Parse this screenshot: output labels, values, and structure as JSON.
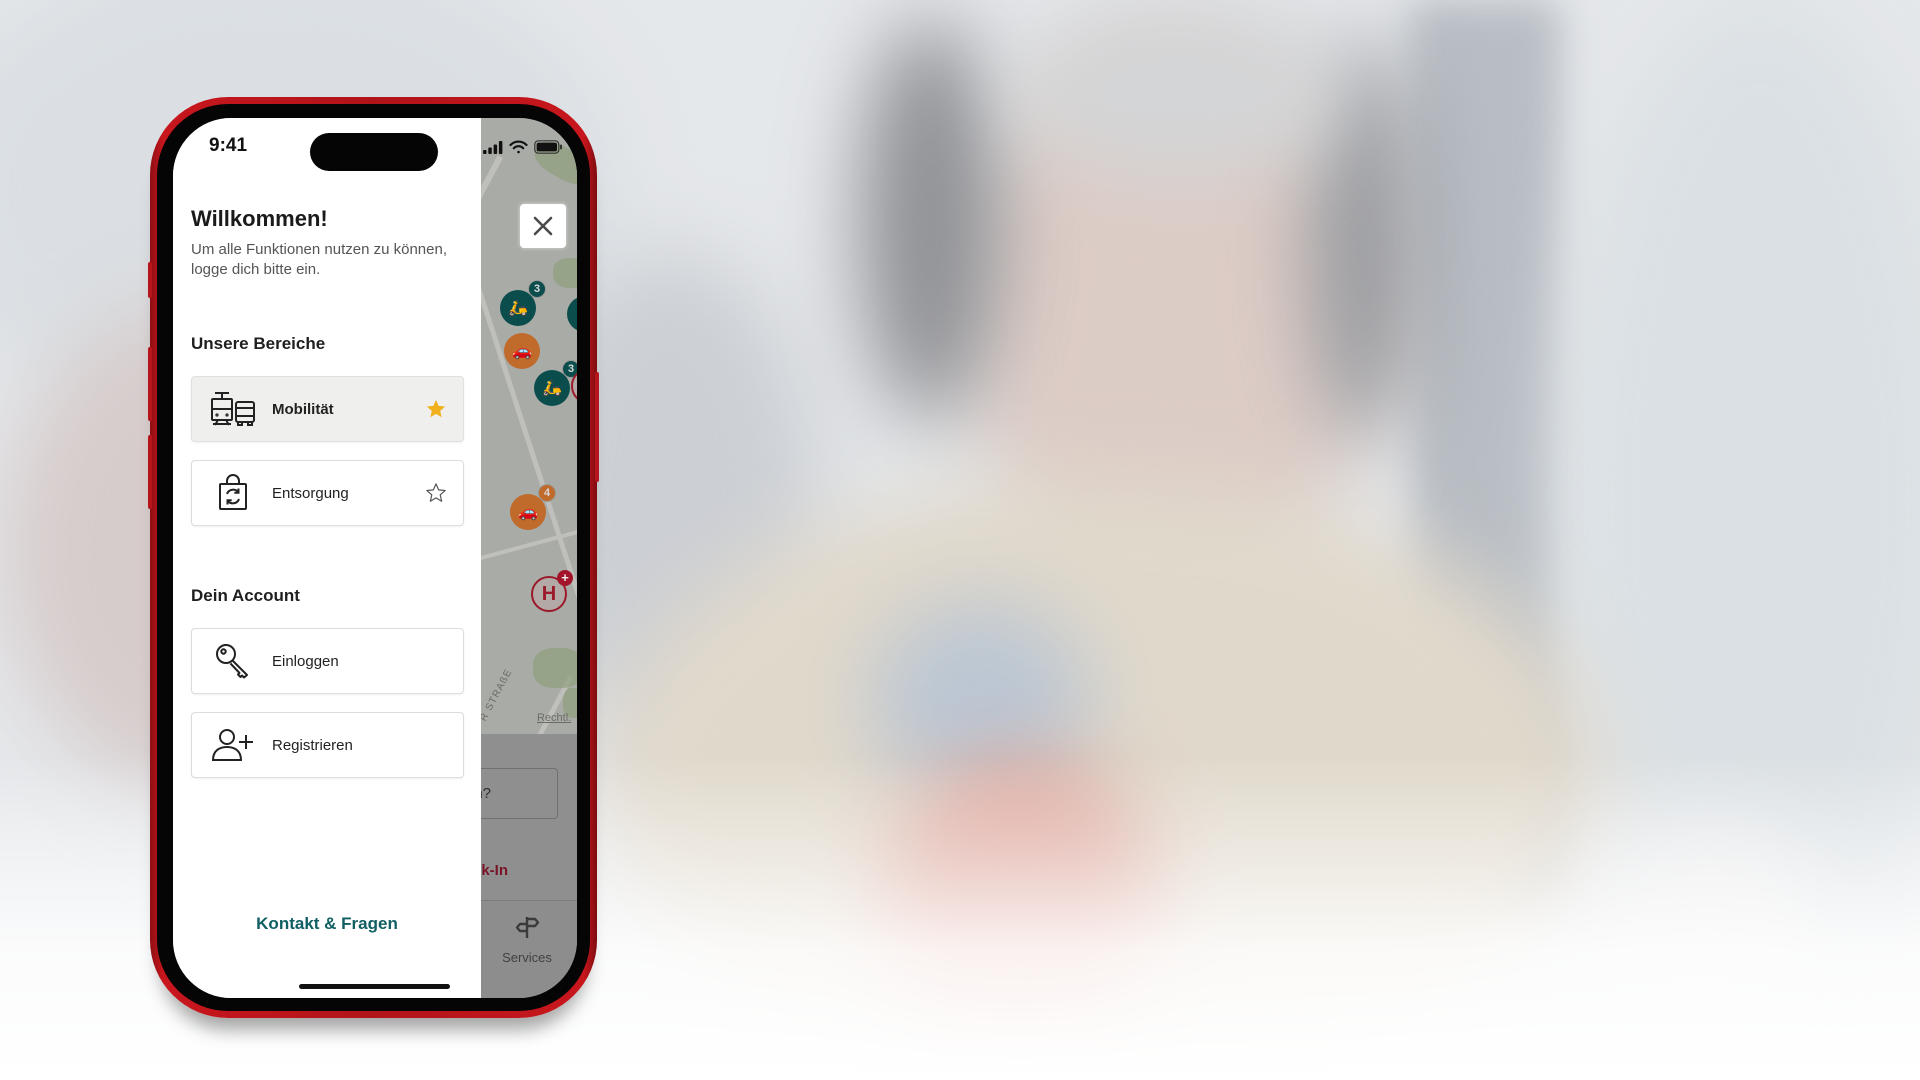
{
  "status_bar": {
    "time": "9:41",
    "icons": [
      "cellular-signal-icon",
      "wifi-icon",
      "battery-icon"
    ]
  },
  "drawer": {
    "title": "Willkommen!",
    "subtitle": "Um alle Funktionen nutzen zu können, logge dich bitte ein.",
    "close_icon": "close-icon",
    "sections": {
      "areas": {
        "heading": "Unsere Bereiche",
        "items": [
          {
            "label": "Mobilität",
            "icon": "tram-bus-icon",
            "favorite": true,
            "active": true
          },
          {
            "label": "Entsorgung",
            "icon": "recycling-bag-icon",
            "favorite": false,
            "active": false
          }
        ]
      },
      "account": {
        "heading": "Dein Account",
        "items": [
          {
            "label": "Einloggen",
            "icon": "key-icon"
          },
          {
            "label": "Registrieren",
            "icon": "add-user-icon"
          }
        ]
      }
    },
    "footer_link": "Kontakt & Fragen"
  },
  "background_app": {
    "map": {
      "markers": [
        {
          "type": "scooter",
          "count": "3"
        },
        {
          "type": "car",
          "count": ""
        },
        {
          "type": "scooter",
          "count": "3"
        },
        {
          "type": "car",
          "count": "4"
        },
        {
          "type": "hospital",
          "label": "H",
          "badge": "+"
        }
      ],
      "street_label": "R STRAßE",
      "legal_link": "Rechtl."
    },
    "search_input_value": "n?",
    "link_partial": "k-In",
    "tab_services": "Services"
  },
  "colors": {
    "brand_red": "#c8161d",
    "teal_link": "#0f5f63",
    "star_active": "#f2b01e",
    "marker_teal": "#0b4d4d",
    "marker_orange": "#c06a2b"
  }
}
